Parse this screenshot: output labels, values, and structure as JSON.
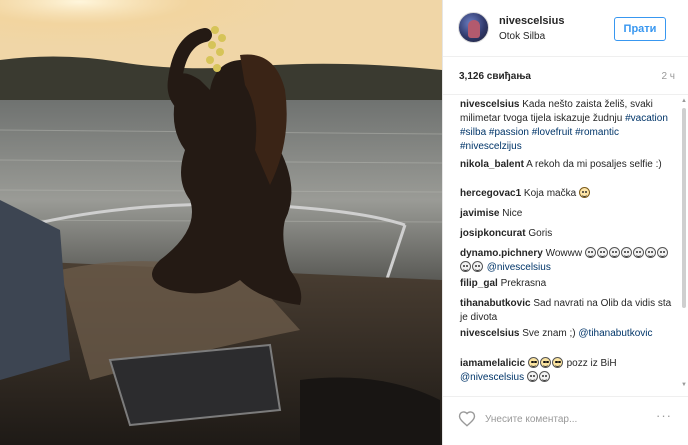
{
  "post": {
    "username": "nivescelsius",
    "location": "Otok Silba",
    "follow_label": "Прати",
    "likes": "3,126 свиђања",
    "time": "2 ч",
    "comment_placeholder": "Унесите коментар...",
    "more_label": "···"
  },
  "comments": [
    {
      "user": "nivescelsius",
      "parts": [
        {
          "t": "text",
          "v": " Kada nešto zaista želiš, svaki milimetar tvoga tijela iskazuje žudnju "
        },
        {
          "t": "tag",
          "v": "#vacation"
        },
        {
          "t": "text",
          "v": " "
        },
        {
          "t": "tag",
          "v": "#silba"
        },
        {
          "t": "text",
          "v": " "
        },
        {
          "t": "tag",
          "v": "#passion"
        },
        {
          "t": "text",
          "v": " "
        },
        {
          "t": "tag",
          "v": "#lovefruit"
        },
        {
          "t": "text",
          "v": " "
        },
        {
          "t": "tag",
          "v": "#romantic"
        },
        {
          "t": "text",
          "v": " "
        },
        {
          "t": "tag",
          "v": "#nivescelzijus"
        }
      ]
    },
    {
      "user": "nikola_balent",
      "parts": [
        {
          "t": "text",
          "v": " A rekoh da mi posaljes selfie :)"
        }
      ]
    },
    {
      "user": "hercegovac1",
      "parts": [
        {
          "t": "text",
          "v": " Koja mačka "
        },
        {
          "t": "emoji",
          "v": "cat"
        }
      ]
    },
    {
      "user": "javimise",
      "parts": [
        {
          "t": "text",
          "v": " Nice"
        }
      ]
    },
    {
      "user": "josipkoncurat",
      "parts": [
        {
          "t": "text",
          "v": " Goris"
        }
      ]
    },
    {
      "user": "dynamo.pichnery",
      "parts": [
        {
          "t": "text",
          "v": " Wowww "
        },
        {
          "t": "emoji",
          "v": "smile"
        },
        {
          "t": "emoji",
          "v": "smile"
        },
        {
          "t": "emoji",
          "v": "smile"
        },
        {
          "t": "emoji",
          "v": "smile"
        },
        {
          "t": "emoji",
          "v": "smile"
        },
        {
          "t": "emoji",
          "v": "smile"
        },
        {
          "t": "emoji",
          "v": "smile"
        },
        {
          "t": "emoji",
          "v": "smile"
        },
        {
          "t": "emoji",
          "v": "smile"
        },
        {
          "t": "text",
          "v": " "
        },
        {
          "t": "tag",
          "v": "@nivescelsius"
        }
      ]
    },
    {
      "user": "filip_gal",
      "parts": [
        {
          "t": "text",
          "v": " Prekrasna"
        }
      ]
    },
    {
      "user": "tihanabutkovic",
      "parts": [
        {
          "t": "text",
          "v": " Sad navrati na Olib da vidis sta je divota"
        }
      ]
    },
    {
      "user": "nivescelsius",
      "parts": [
        {
          "t": "text",
          "v": " Sve znam ;) "
        },
        {
          "t": "tag",
          "v": "@tihanabutkovic"
        }
      ]
    },
    {
      "user": "iamamelalicic",
      "parts": [
        {
          "t": "text",
          "v": " "
        },
        {
          "t": "emoji",
          "v": "cool"
        },
        {
          "t": "emoji",
          "v": "cool"
        },
        {
          "t": "emoji",
          "v": "cool"
        },
        {
          "t": "text",
          "v": " pozz iz BiH "
        },
        {
          "t": "tag",
          "v": "@nivescelsius"
        },
        {
          "t": "text",
          "v": " "
        },
        {
          "t": "emoji",
          "v": "smile"
        },
        {
          "t": "emoji",
          "v": "smile"
        }
      ]
    }
  ],
  "icons": {
    "heart": "heart-icon",
    "emoji_smile": "smile-emoji-icon",
    "emoji_cool": "sunglasses-emoji-icon",
    "emoji_cat": "cat-emoji-icon"
  },
  "colors": {
    "follow_blue": "#3897f0",
    "tag_blue": "#003569",
    "muted": "#999999"
  }
}
